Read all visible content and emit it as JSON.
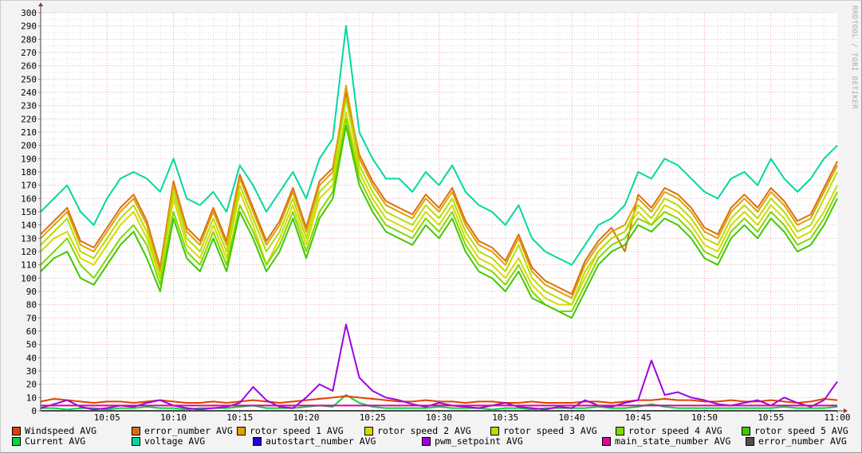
{
  "watermark": "RRDTOOL / TOBI OETIKER",
  "chart_data": {
    "type": "line",
    "title": "",
    "xlabel": "",
    "ylabel": "",
    "ylim": [
      0,
      300
    ],
    "yticks": [
      0,
      10,
      20,
      30,
      40,
      50,
      60,
      70,
      80,
      90,
      100,
      110,
      120,
      130,
      140,
      150,
      160,
      170,
      180,
      190,
      200,
      210,
      220,
      230,
      240,
      250,
      260,
      270,
      280,
      290,
      300
    ],
    "xlim_minutes": [
      0,
      60
    ],
    "xticks": [
      {
        "min": 5,
        "label": "10:05"
      },
      {
        "min": 10,
        "label": "10:10"
      },
      {
        "min": 15,
        "label": "10:15"
      },
      {
        "min": 20,
        "label": "10:20"
      },
      {
        "min": 25,
        "label": "10:25"
      },
      {
        "min": 30,
        "label": "10:30"
      },
      {
        "min": 35,
        "label": "10:35"
      },
      {
        "min": 40,
        "label": "10:40"
      },
      {
        "min": 45,
        "label": "10:45"
      },
      {
        "min": 50,
        "label": "10:50"
      },
      {
        "min": 55,
        "label": "10:55"
      },
      {
        "min": 60,
        "label": "11:00"
      }
    ],
    "x_note": "minutes after 10:00, one sample per minute",
    "grid": true,
    "legend_position": "bottom",
    "series": [
      {
        "name": "Windspeed AVG",
        "color": "#e04000",
        "values": [
          7,
          9,
          8,
          7,
          6,
          7,
          7,
          6,
          7,
          8,
          7,
          6,
          6,
          7,
          6,
          7,
          8,
          7,
          6,
          7,
          8,
          9,
          10,
          11,
          10,
          9,
          8,
          7,
          7,
          8,
          7,
          7,
          6,
          7,
          7,
          6,
          6,
          7,
          6,
          6,
          6,
          7,
          7,
          6,
          7,
          8,
          8,
          9,
          8,
          8,
          7,
          7,
          8,
          7,
          7,
          8,
          7,
          6,
          7,
          9,
          8
        ]
      },
      {
        "name": "error_number AVG",
        "color": "#d87010",
        "values": [
          133,
          143,
          153,
          128,
          123,
          138,
          153,
          163,
          143,
          108,
          173,
          138,
          128,
          153,
          128,
          178,
          153,
          128,
          143,
          168,
          138,
          173,
          183,
          240,
          193,
          173,
          158,
          153,
          148,
          163,
          153,
          168,
          143,
          128,
          123,
          113,
          133,
          108,
          98,
          93,
          88,
          113,
          128,
          138,
          120,
          163,
          153,
          168,
          163,
          153,
          138,
          133,
          153,
          163,
          153,
          168,
          158,
          143,
          148,
          168,
          188
        ]
      },
      {
        "name": "rotor speed 1 AVG",
        "color": "#e0a000",
        "values": [
          130,
          140,
          150,
          125,
          120,
          135,
          150,
          160,
          140,
          105,
          170,
          135,
          125,
          150,
          125,
          175,
          150,
          125,
          140,
          165,
          135,
          170,
          180,
          245,
          190,
          170,
          155,
          150,
          145,
          160,
          150,
          165,
          140,
          125,
          120,
          110,
          130,
          105,
          95,
          90,
          85,
          110,
          125,
          135,
          140,
          160,
          150,
          165,
          160,
          150,
          135,
          130,
          150,
          160,
          150,
          165,
          155,
          140,
          145,
          165,
          185
        ]
      },
      {
        "name": "rotor speed 2 AVG",
        "color": "#d8d800",
        "values": [
          120,
          130,
          135,
          115,
          110,
          125,
          140,
          150,
          130,
          100,
          160,
          125,
          115,
          140,
          115,
          165,
          140,
          110,
          130,
          155,
          125,
          160,
          170,
          225,
          180,
          160,
          145,
          140,
          135,
          150,
          140,
          155,
          130,
          115,
          110,
          100,
          115,
          95,
          85,
          80,
          80,
          100,
          120,
          130,
          135,
          150,
          140,
          155,
          150,
          140,
          125,
          120,
          140,
          150,
          140,
          155,
          145,
          130,
          135,
          150,
          170
        ]
      },
      {
        "name": "rotor speed 3 AVG",
        "color": "#b0e000",
        "values": [
          125,
          135,
          145,
          120,
          115,
          130,
          145,
          155,
          135,
          100,
          165,
          130,
          120,
          145,
          120,
          170,
          145,
          120,
          135,
          160,
          130,
          165,
          175,
          235,
          185,
          165,
          150,
          145,
          140,
          155,
          145,
          160,
          135,
          120,
          115,
          105,
          125,
          100,
          90,
          85,
          80,
          105,
          120,
          130,
          135,
          155,
          145,
          160,
          155,
          145,
          130,
          125,
          145,
          155,
          145,
          160,
          150,
          135,
          140,
          160,
          180
        ]
      },
      {
        "name": "rotor speed 4 AVG",
        "color": "#80d800",
        "values": [
          110,
          120,
          130,
          110,
          100,
          115,
          130,
          140,
          125,
          95,
          150,
          120,
          110,
          135,
          110,
          155,
          135,
          110,
          125,
          150,
          120,
          150,
          165,
          220,
          175,
          155,
          140,
          135,
          130,
          145,
          135,
          150,
          125,
          110,
          105,
          95,
          110,
          90,
          80,
          75,
          75,
          95,
          115,
          125,
          130,
          145,
          140,
          150,
          145,
          135,
          120,
          115,
          135,
          145,
          135,
          150,
          140,
          125,
          130,
          145,
          165
        ]
      },
      {
        "name": "rotor speed 5 AVG",
        "color": "#40c800",
        "values": [
          105,
          115,
          120,
          100,
          95,
          110,
          125,
          135,
          115,
          90,
          145,
          115,
          105,
          130,
          105,
          150,
          130,
          105,
          120,
          145,
          115,
          145,
          160,
          215,
          170,
          150,
          135,
          130,
          125,
          140,
          130,
          145,
          120,
          105,
          100,
          90,
          105,
          85,
          80,
          75,
          70,
          90,
          110,
          120,
          125,
          140,
          135,
          145,
          140,
          130,
          115,
          110,
          130,
          140,
          130,
          145,
          135,
          120,
          125,
          140,
          160
        ]
      },
      {
        "name": "Current AVG",
        "color": "#00d840",
        "values": [
          2,
          2,
          1,
          2,
          2,
          1,
          2,
          2,
          3,
          2,
          2,
          1,
          2,
          2,
          2,
          3,
          4,
          2,
          2,
          2,
          3,
          4,
          3,
          12,
          6,
          3,
          2,
          2,
          2,
          2,
          3,
          2,
          2,
          2,
          1,
          2,
          2,
          1,
          2,
          2,
          2,
          2,
          3,
          2,
          2,
          3,
          5,
          3,
          2,
          2,
          2,
          2,
          2,
          2,
          2,
          2,
          3,
          2,
          2,
          2,
          3
        ]
      },
      {
        "name": "voltage AVG",
        "color": "#00d8a0",
        "values": [
          150,
          160,
          170,
          150,
          140,
          160,
          175,
          180,
          175,
          165,
          190,
          160,
          155,
          165,
          150,
          185,
          170,
          150,
          165,
          180,
          160,
          190,
          205,
          290,
          210,
          190,
          175,
          175,
          165,
          180,
          170,
          185,
          165,
          155,
          150,
          140,
          155,
          130,
          120,
          115,
          110,
          125,
          140,
          145,
          155,
          180,
          175,
          190,
          185,
          175,
          165,
          160,
          175,
          180,
          170,
          190,
          175,
          165,
          175,
          190,
          200
        ]
      },
      {
        "name": "autostart_number AVG",
        "color": "#2000e0",
        "values": [
          0,
          0,
          0,
          0,
          0,
          0,
          0,
          0,
          0,
          0,
          0,
          0,
          0,
          0,
          0,
          0,
          0,
          0,
          0,
          0,
          0,
          0,
          0,
          0,
          0,
          0,
          0,
          0,
          0,
          0,
          0,
          0,
          0,
          0,
          0,
          0,
          0,
          0,
          0,
          0,
          0,
          0,
          0,
          0,
          0,
          0,
          0,
          0,
          0,
          0,
          0,
          0,
          0,
          0,
          0,
          0,
          0,
          0,
          0,
          0,
          0
        ]
      },
      {
        "name": "pwm_setpoint AVG",
        "color": "#a000e0",
        "values": [
          2,
          5,
          8,
          3,
          1,
          2,
          4,
          3,
          6,
          8,
          4,
          2,
          1,
          2,
          3,
          6,
          18,
          8,
          3,
          2,
          10,
          20,
          15,
          65,
          25,
          15,
          10,
          8,
          5,
          3,
          6,
          4,
          3,
          2,
          4,
          6,
          3,
          2,
          1,
          3,
          2,
          8,
          4,
          3,
          6,
          8,
          38,
          12,
          14,
          10,
          8,
          5,
          4,
          6,
          8,
          4,
          10,
          6,
          3,
          8,
          22
        ]
      },
      {
        "name": "main_state_number AVG",
        "color": "#e000a0",
        "values": [
          4,
          4,
          4,
          4,
          4,
          4,
          4,
          4,
          4,
          4,
          4,
          4,
          4,
          4,
          4,
          4,
          4,
          4,
          4,
          4,
          4,
          4,
          4,
          4,
          4,
          4,
          4,
          4,
          4,
          4,
          4,
          4,
          4,
          4,
          4,
          4,
          4,
          4,
          4,
          4,
          4,
          4,
          4,
          4,
          4,
          4,
          4,
          4,
          4,
          4,
          4,
          4,
          4,
          4,
          4,
          4,
          4,
          4,
          4,
          4,
          4
        ]
      },
      {
        "name": "error_number AVG",
        "color": "#505050",
        "values": [
          0,
          0,
          0,
          0,
          0,
          0,
          0,
          0,
          0,
          0,
          0,
          0,
          0,
          0,
          0,
          0,
          0,
          0,
          0,
          0,
          0,
          0,
          0,
          0,
          0,
          0,
          0,
          0,
          0,
          0,
          0,
          0,
          0,
          0,
          0,
          0,
          0,
          0,
          0,
          0,
          0,
          0,
          0,
          0,
          0,
          0,
          0,
          0,
          0,
          0,
          0,
          0,
          0,
          0,
          0,
          0,
          0,
          0,
          0,
          0,
          0
        ]
      }
    ],
    "draw_order": [
      9,
      12,
      7,
      0,
      10,
      11,
      1,
      2,
      3,
      4,
      5,
      6,
      8
    ]
  }
}
